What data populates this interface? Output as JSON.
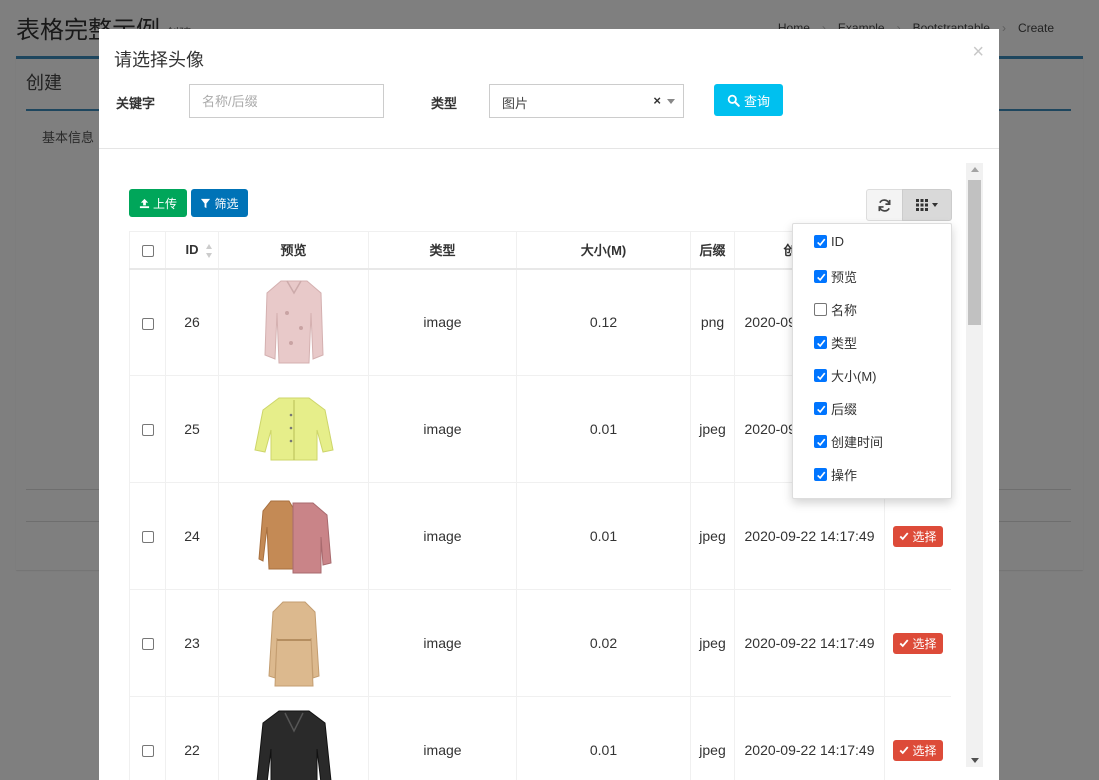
{
  "background": {
    "title": "表格完整示例",
    "subtitle": "创建",
    "breadcrumb": [
      "Home",
      "Example",
      "Bootstraptable",
      "Create"
    ],
    "box_title": "创建",
    "tab": "基本信息"
  },
  "modal": {
    "title": "请选择头像",
    "close": "×",
    "keyword_label": "关键字",
    "keyword_placeholder": "名称/后缀",
    "keyword_value": "",
    "type_label": "类型",
    "type_value": "图片",
    "type_clear": "×",
    "query_label": "查询"
  },
  "toolbar": {
    "upload_label": "上传",
    "filter_label": "筛选"
  },
  "table": {
    "headers": {
      "id": "ID",
      "preview": "预览",
      "type": "类型",
      "size": "大小(M)",
      "suffix": "后缀",
      "created": "创建时间"
    },
    "select_label": "选择",
    "rows": [
      {
        "id": "26",
        "type": "image",
        "size": "0.12",
        "suffix": "png",
        "created": "2020-09-22 14:17:49",
        "item": "pink-blouse"
      },
      {
        "id": "25",
        "type": "image",
        "size": "0.01",
        "suffix": "jpeg",
        "created": "2020-09-22 14:17:49",
        "item": "yellow-jacket"
      },
      {
        "id": "24",
        "type": "image",
        "size": "0.01",
        "suffix": "jpeg",
        "created": "2020-09-22 14:17:49",
        "item": "coats-pair"
      },
      {
        "id": "23",
        "type": "image",
        "size": "0.02",
        "suffix": "jpeg",
        "created": "2020-09-22 14:17:49",
        "item": "trench-coat"
      },
      {
        "id": "22",
        "type": "image",
        "size": "0.01",
        "suffix": "jpeg",
        "created": "2020-09-22 14:17:49",
        "item": "leather-jacket"
      }
    ]
  },
  "column_menu": [
    {
      "label": "ID",
      "checked": true
    },
    {
      "label": "预览",
      "checked": true
    },
    {
      "label": "名称",
      "checked": false
    },
    {
      "label": "类型",
      "checked": true
    },
    {
      "label": "大小(M)",
      "checked": true
    },
    {
      "label": "后缀",
      "checked": true
    },
    {
      "label": "创建时间",
      "checked": true
    },
    {
      "label": "操作",
      "checked": true
    }
  ],
  "colors": {
    "query": "#00c0ef",
    "upload": "#00a65a",
    "filter": "#0073b7",
    "select": "#dd4b39",
    "checkbox": "#0075ff"
  }
}
